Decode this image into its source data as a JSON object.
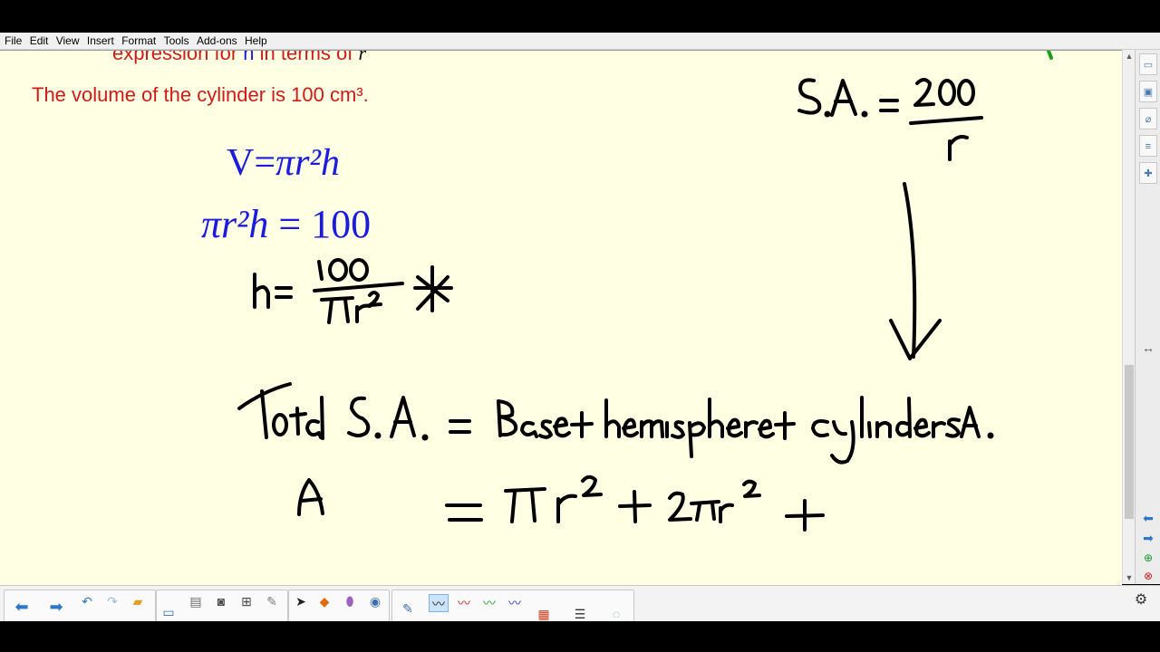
{
  "menu": [
    "File",
    "Edit",
    "View",
    "Insert",
    "Format",
    "Tools",
    "Add-ons",
    "Help"
  ],
  "slide": {
    "partial_heading": "expression for h in terms of r",
    "partial_heading_parts": {
      "pre": "expression for ",
      "h": "h",
      "mid": " in terms of ",
      "r": "r"
    },
    "volume_text": "The volume of the cylinder is 100 cm³.",
    "formula_V": {
      "lhs": "V=",
      "rhs": "πr²h"
    },
    "formula_set": {
      "lhs": "πr²h",
      "rhs": " = 100"
    }
  },
  "colors": {
    "canvas": "#ffffe4",
    "prompt_red": "#d11a1a",
    "formula_blue": "#1a1ae0",
    "ink": "#000000",
    "toolbar_blue": "#2c78c8"
  },
  "icons": {
    "back": "arrow-left-icon",
    "forward": "arrow-right-icon",
    "undo": "undo-icon",
    "redo": "redo-icon",
    "open": "folder-icon",
    "settings": "gear-icon"
  }
}
